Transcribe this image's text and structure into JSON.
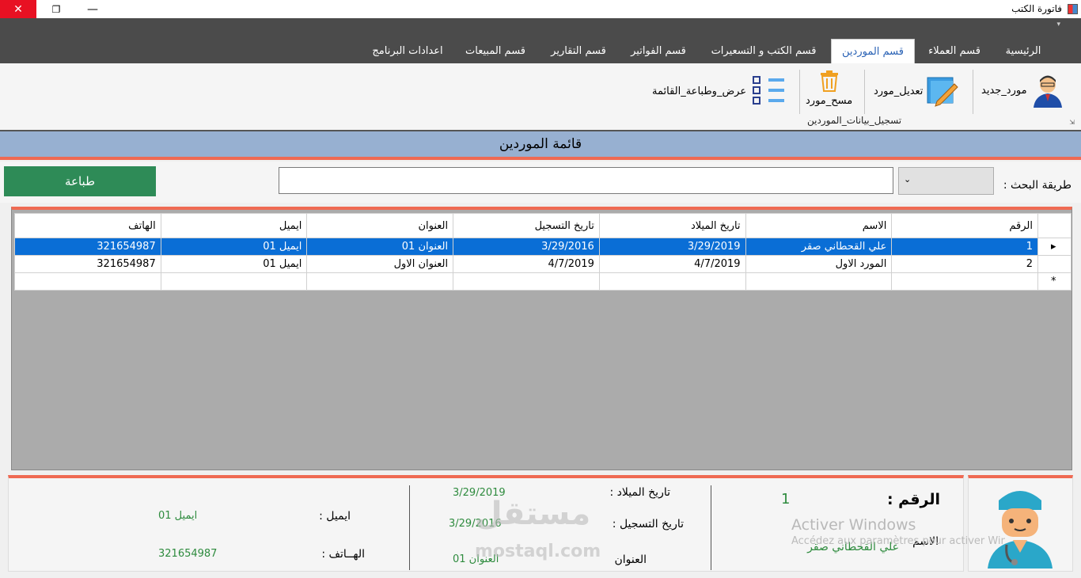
{
  "window": {
    "title": "فاتورة الكتب",
    "close_glyph": "✕",
    "max_glyph": "❐",
    "min_glyph": "—"
  },
  "ribbon": {
    "qat_glyph": "▾",
    "tabs": [
      {
        "label": "الرئيسية"
      },
      {
        "label": "قسم العملاء"
      },
      {
        "label": "قسم الموردين"
      },
      {
        "label": "قسم الكتب و التسعيرات"
      },
      {
        "label": "قسم الفواتير"
      },
      {
        "label": "قسم التقارير"
      },
      {
        "label": "قسم المبيعات"
      },
      {
        "label": "اعدادات البرنامج"
      }
    ],
    "buttons": {
      "new_supplier": "مورد_جديد",
      "edit_supplier": "تعديل_مورد",
      "delete_supplier": "مسح_مورد",
      "view_print": "عرض_وطباعة_القائمة"
    },
    "group_label": "تسجيل_بيانات_الموردين",
    "launcher_glyph": "⇲"
  },
  "list": {
    "title": "قائمة الموردين"
  },
  "search": {
    "print_label": "طباعة",
    "method_label": "طريقة البحث :",
    "input_value": "",
    "select_glyph": "⌄"
  },
  "grid": {
    "columns": [
      "الهاتف",
      "ايميل",
      "العنوان",
      "تاريخ التسجيل",
      "تاريخ الميلاد",
      "الاسم",
      "الرقم"
    ],
    "rows": [
      {
        "phone": "321654987",
        "email": "ايميل 01",
        "address": "العنوان 01",
        "reg_date": "3/29/2016",
        "birth_date": "3/29/2019",
        "name": "علي القحطاني صقر",
        "id": "1",
        "marker": "▸"
      },
      {
        "phone": "321654987",
        "email": "ايميل 01",
        "address": "العنوان الاول",
        "reg_date": "4/7/2019",
        "birth_date": "4/7/2019",
        "name": "المورد الاول",
        "id": "2",
        "marker": ""
      }
    ],
    "new_row_marker": "*"
  },
  "details": {
    "id_label": "الرقم :",
    "id_value": "1",
    "name_label": "الاسم",
    "name_value": "علي القحطاني صقر",
    "birth_label": "تاريخ الميلاد :",
    "birth_value": "3/29/2019",
    "reg_label": "تاريخ التسجيل :",
    "reg_value": "3/29/2016",
    "address_label": "العنوان",
    "address_value": "العنوان 01",
    "email_label": "ايميل :",
    "email_value": "ايميل 01",
    "phone_label": "الهــاتف :",
    "phone_value": "321654987"
  },
  "watermark": {
    "line1": "Activer Windows",
    "line2": "Accédez aux paramètres pour activer Windows.",
    "site_ar": "مستقل",
    "site": "mostaql.com"
  },
  "colors": {
    "accent_red": "#ef6a53",
    "selection_blue": "#0a6ed6",
    "print_green": "#2e8b57",
    "title_bar_blue": "#97b0d1",
    "value_green": "#2e8b3e"
  }
}
